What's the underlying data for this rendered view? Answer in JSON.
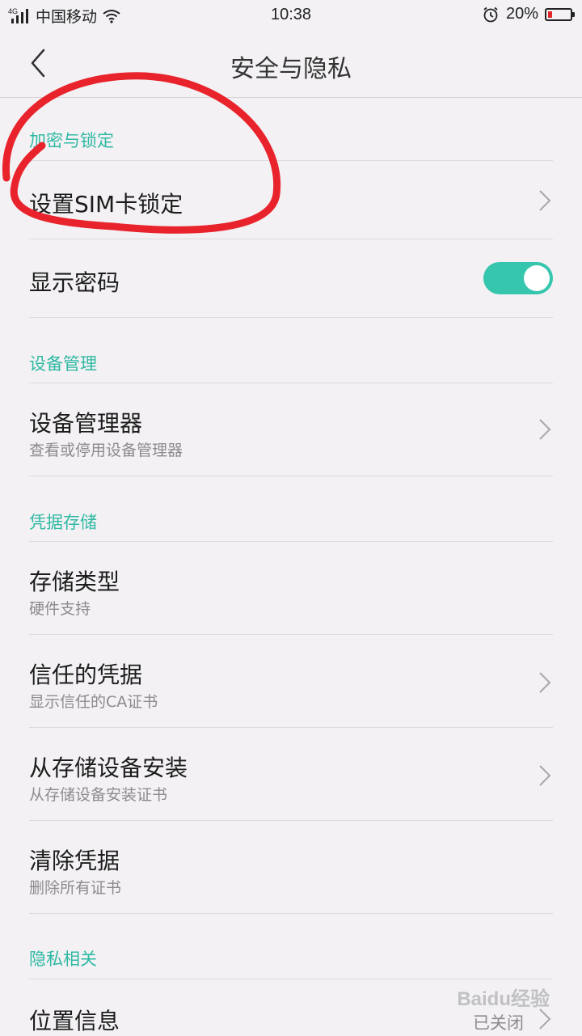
{
  "status_bar": {
    "network": "4G",
    "carrier": "中国移动",
    "time": "10:38",
    "battery_percent": "20%",
    "battery_level": 0.2,
    "battery_color": "#e0262a",
    "icons": [
      "signal-icon",
      "wifi-icon",
      "alarm-icon",
      "battery-icon"
    ]
  },
  "header": {
    "title": "安全与隐私",
    "back_icon": "chevron-left-icon"
  },
  "sections": {
    "encryption": {
      "header": "加密与锁定",
      "sim_lock": {
        "title": "设置SIM卡锁定"
      },
      "show_password": {
        "title": "显示密码",
        "toggle_on": true
      }
    },
    "device": {
      "header": "设备管理",
      "device_admin": {
        "title": "设备管理器",
        "subtitle": "查看或停用设备管理器"
      }
    },
    "credentials": {
      "header": "凭据存储",
      "storage_type": {
        "title": "存储类型",
        "subtitle": "硬件支持"
      },
      "trusted": {
        "title": "信任的凭据",
        "subtitle": "显示信任的CA证书"
      },
      "install": {
        "title": "从存储设备安装",
        "subtitle": "从存储设备安装证书"
      },
      "clear": {
        "title": "清除凭据",
        "subtitle": "删除所有证书"
      }
    },
    "privacy": {
      "header": "隐私相关",
      "location": {
        "title": "位置信息",
        "value": "已关闭"
      }
    }
  },
  "colors": {
    "accent": "#2fb9a3",
    "toggle_on": "#36c5ad",
    "annotation": "#e8232c",
    "background": "#f3f1f4"
  },
  "watermark": "Baidu经验"
}
